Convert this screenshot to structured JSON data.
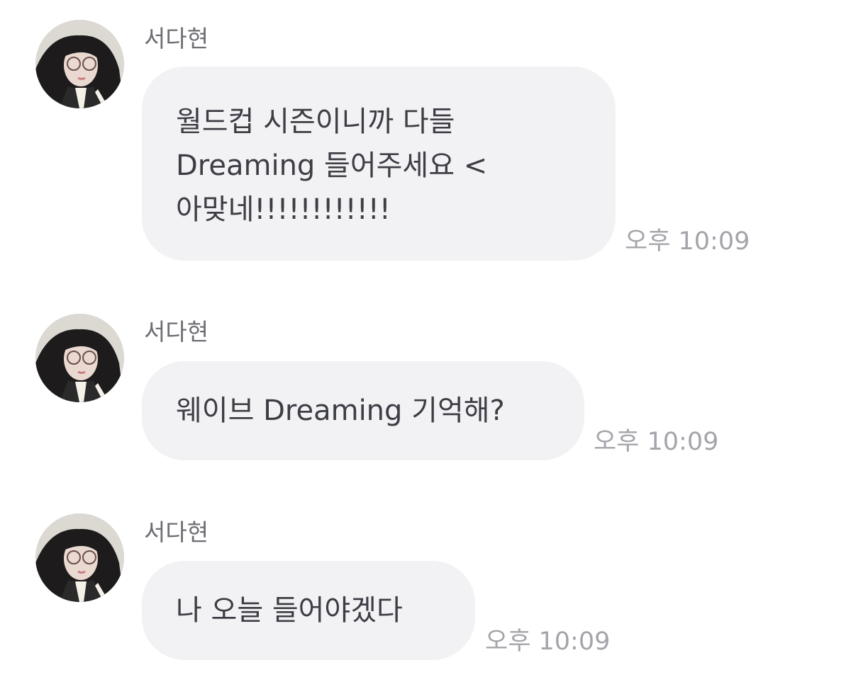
{
  "chat": {
    "messages": [
      {
        "sender": "서다현",
        "text": "월드컵 시즌이니까 다들\nDreaming 들어주세요 <\n아맞네!!!!!!!!!!!!",
        "time": "오후 10:09",
        "avatar_icon": "profile-photo-avatar"
      },
      {
        "sender": "서다현",
        "text": "웨이브 Dreaming 기억해?",
        "time": "오후 10:09",
        "avatar_icon": "profile-photo-avatar"
      },
      {
        "sender": "서다현",
        "text": "나 오늘 들어야겠다",
        "time": "오후 10:09",
        "avatar_icon": "profile-photo-avatar"
      }
    ]
  },
  "colors": {
    "background": "#ffffff",
    "bubble": "#f2f2f4",
    "message_text": "#3d3e45",
    "sender_text": "#6d6e73",
    "time_text": "#a4a5aa"
  }
}
